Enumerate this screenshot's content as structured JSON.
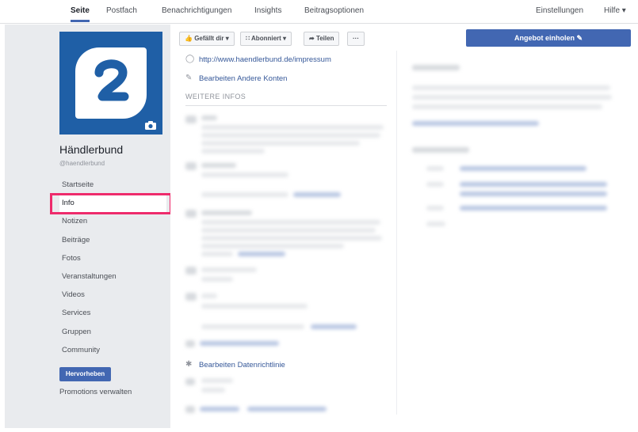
{
  "topnav": {
    "tabs": [
      "Seite",
      "Postfach",
      "Benachrichtigungen",
      "Insights",
      "Beitragsoptionen"
    ],
    "settings": "Einstellungen",
    "help": "Hilfe ▾"
  },
  "profile": {
    "name": "Händlerbund",
    "handle": "@haendlerbund"
  },
  "nav": [
    "Startseite",
    "Info",
    "Notizen",
    "Beiträge",
    "Fotos",
    "Veranstaltungen",
    "Videos",
    "Services",
    "Gruppen",
    "Community"
  ],
  "promo": {
    "button": "Hervorheben",
    "link": "Promotions verwalten"
  },
  "toolbar": {
    "like": "Gefällt dir ▾",
    "follow": "Abonniert ▾",
    "share": "Teilen",
    "more": "···",
    "cta": "Angebot einholen"
  },
  "info": {
    "website": "http://www.haendlerbund.de/impressum",
    "edit_accounts": "Bearbeiten Andere Konten",
    "more_heading": "WEITERE INFOS",
    "privacy": "Bearbeiten Datenrichtlinie"
  },
  "icons": {
    "globe": "globe-icon",
    "edit": "edit-icon",
    "camera": "camera-icon",
    "like": "thumbs-up-icon",
    "rss": "rss-icon",
    "share": "share-icon",
    "pencil": "pencil-icon",
    "privacy": "shield-icon"
  },
  "colors": {
    "brand": "#1f5fa6",
    "accent": "#4267b2",
    "highlight": "#ee2b6c"
  }
}
